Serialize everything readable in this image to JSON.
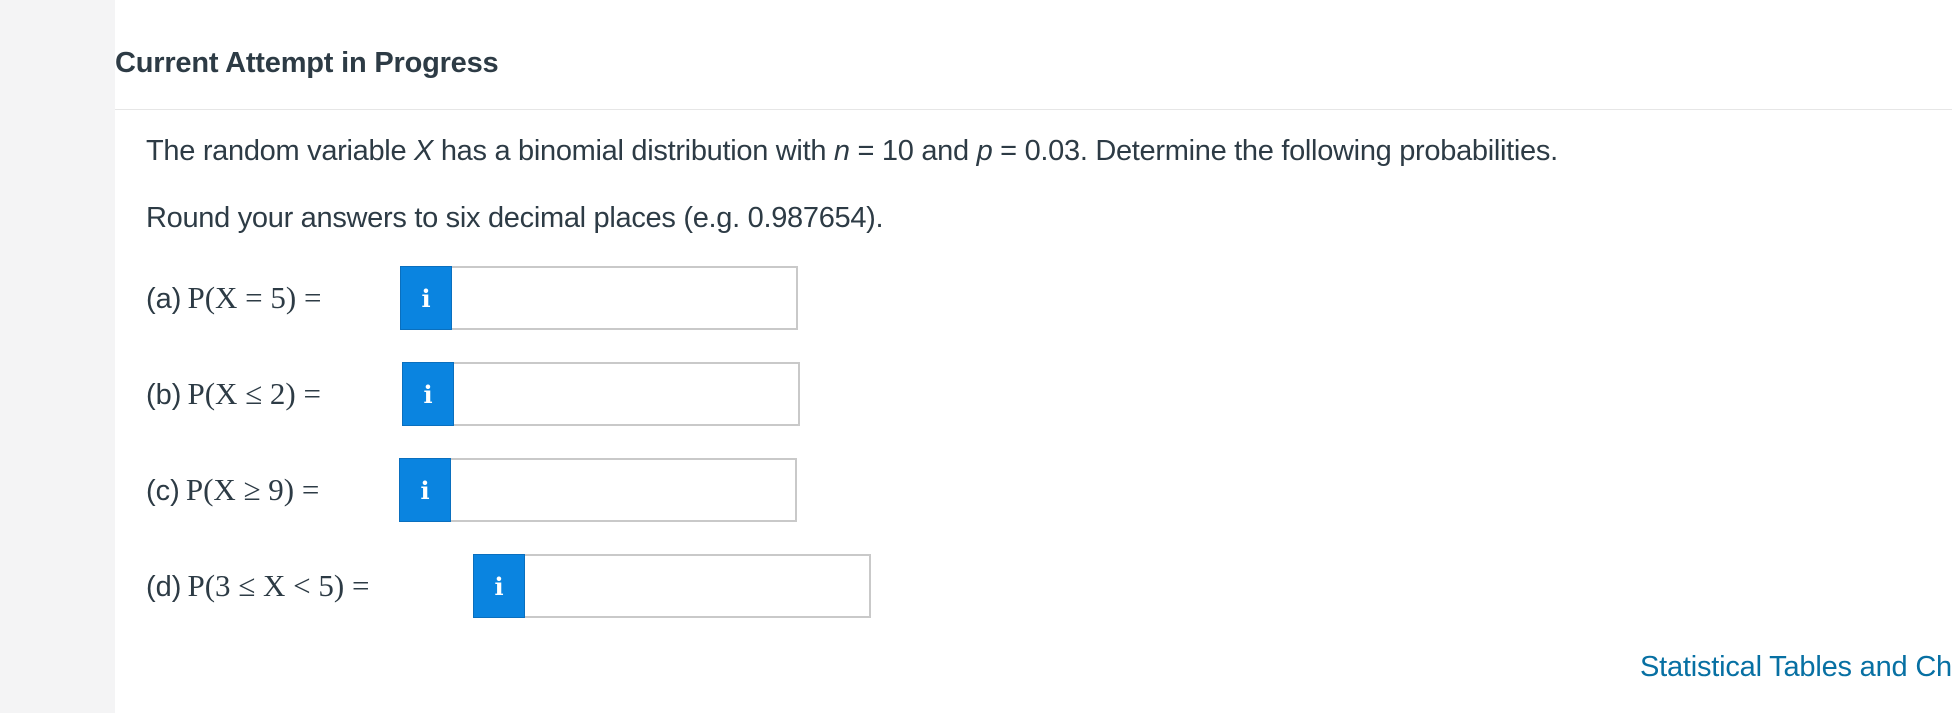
{
  "header": {
    "title": "Current Attempt in Progress"
  },
  "question": {
    "part1": "The random variable ",
    "var_x": "X",
    "part2": " has a binomial distribution with ",
    "var_n": "n",
    "part3": " = 10 and ",
    "var_p": "p",
    "part4": " = 0.03. Determine the following probabilities."
  },
  "instruction": "Round your answers to six decimal places (e.g. 0.987654).",
  "parts": [
    {
      "label": "(a)",
      "expr": "P(X = 5) =",
      "value": ""
    },
    {
      "label": "(b)",
      "expr": "P(X ≤ 2) =",
      "value": ""
    },
    {
      "label": "(c)",
      "expr": "P(X ≥ 9) =",
      "value": ""
    },
    {
      "label": "(d)",
      "expr": "P(3 ≤ X < 5) =",
      "value": ""
    }
  ],
  "info_icon_glyph": "i",
  "icons": {
    "info": "info-icon"
  },
  "colors": {
    "info_button": "#0a84e0",
    "link": "#0770a3",
    "text": "#2d3b45"
  },
  "footer": {
    "link_text": "Statistical Tables and Ch"
  }
}
